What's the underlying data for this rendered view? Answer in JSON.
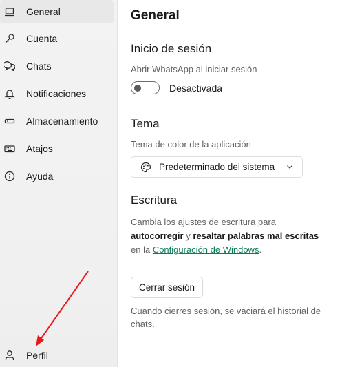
{
  "sidebar": {
    "items": [
      {
        "label": "General",
        "icon": "laptop-icon",
        "active": true
      },
      {
        "label": "Cuenta",
        "icon": "key-icon"
      },
      {
        "label": "Chats",
        "icon": "chat-bubbles-icon"
      },
      {
        "label": "Notificaciones",
        "icon": "bell-icon"
      },
      {
        "label": "Almacenamiento",
        "icon": "storage-icon"
      },
      {
        "label": "Atajos",
        "icon": "keyboard-icon"
      },
      {
        "label": "Ayuda",
        "icon": "info-icon"
      }
    ],
    "profile": {
      "label": "Perfil",
      "icon": "person-icon"
    }
  },
  "main": {
    "title": "General",
    "login": {
      "heading": "Inicio de sesión",
      "description": "Abrir WhatsApp al iniciar sesión",
      "toggle_state": "Desactivada",
      "toggle_on": false
    },
    "theme": {
      "heading": "Tema",
      "description": "Tema de color de la aplicación",
      "selected": "Predeterminado del sistema"
    },
    "typing": {
      "heading": "Escritura",
      "text_1": "Cambia los ajustes de escritura para",
      "bold_1": "autocorregir",
      "text_2": " y ",
      "bold_2": "resaltar palabras mal escritas",
      "text_3": "en la ",
      "link": "Configuración de Windows",
      "text_4": "."
    },
    "logout": {
      "button": "Cerrar sesión",
      "note": "Cuando cierres sesión, se vaciará el historial de chats."
    }
  },
  "colors": {
    "accent_link": "#0b7a5a",
    "annotation_arrow": "#e8191b"
  }
}
